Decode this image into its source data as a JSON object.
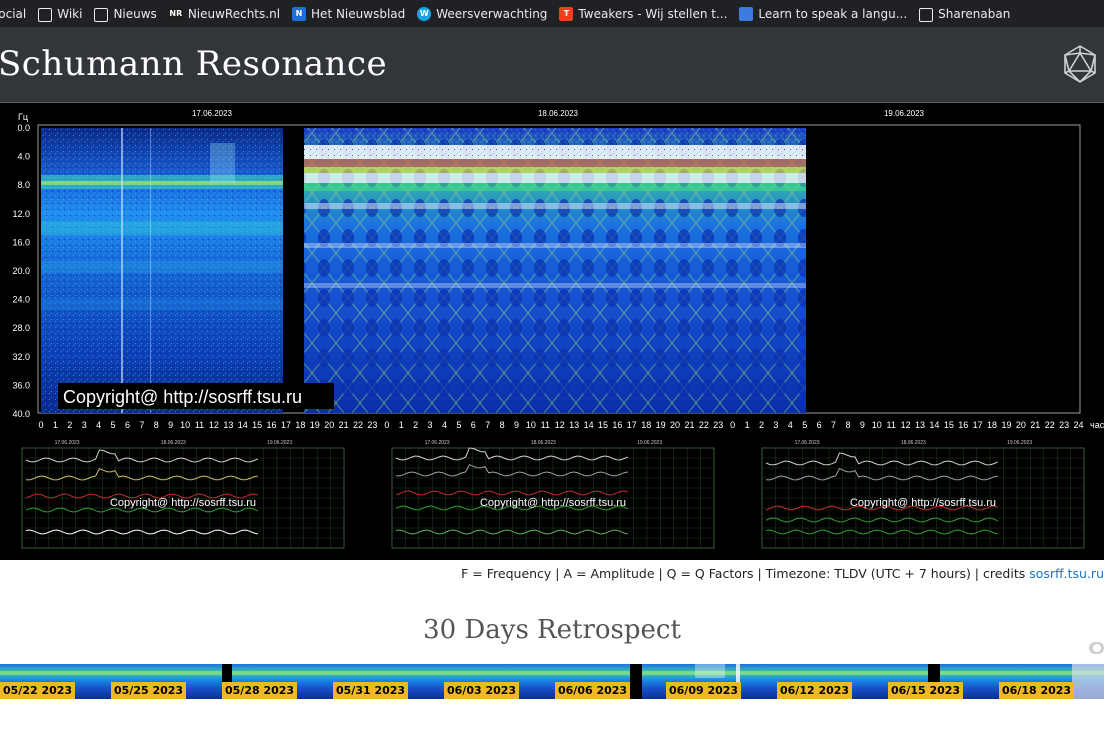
{
  "bookmarks": [
    {
      "label": "social",
      "icon": "folder-icon"
    },
    {
      "label": "Wiki",
      "icon": "folder-icon"
    },
    {
      "label": "Nieuws",
      "icon": "folder-icon"
    },
    {
      "label": "NieuwRechts.nl",
      "icon": "nieuwrechts-favicon",
      "badge": "NR",
      "color": "#1c1c1c"
    },
    {
      "label": "Het Nieuwsblad",
      "icon": "nieuwsblad-favicon",
      "badge": "N",
      "color": "#1e6fd9"
    },
    {
      "label": "Weersverwachting",
      "icon": "weather-favicon",
      "badge": "W",
      "color": "#1aa3e0"
    },
    {
      "label": "Tweakers - Wij stellen t...",
      "icon": "tweakers-favicon",
      "badge": "T",
      "color": "#e8431c"
    },
    {
      "label": "Learn to speak a langu...",
      "icon": "language-favicon",
      "badge": "",
      "color": "#3d7be0"
    },
    {
      "label": "Sharenaban",
      "icon": "folder-icon"
    }
  ],
  "page": {
    "title": "Schumann Resonance",
    "logo_icon": "icosahedron-icon"
  },
  "spectrogram": {
    "y_unit": "Гц",
    "x_unit": "час",
    "y_ticks": [
      "0.0",
      "4.0",
      "8.0",
      "12.0",
      "16.0",
      "20.0",
      "24.0",
      "28.0",
      "32.0",
      "36.0",
      "40.0"
    ],
    "dates": [
      "17.06.2023",
      "18.06.2023",
      "19.06.2023"
    ],
    "hour_ticks": [
      "0",
      "1",
      "2",
      "3",
      "4",
      "5",
      "6",
      "7",
      "8",
      "9",
      "10",
      "11",
      "12",
      "13",
      "14",
      "15",
      "16",
      "17",
      "18",
      "19",
      "20",
      "21",
      "22",
      "23",
      "0",
      "1",
      "2",
      "3",
      "4",
      "5",
      "6",
      "7",
      "8",
      "9",
      "10",
      "11",
      "12",
      "13",
      "14",
      "15",
      "16",
      "17",
      "18",
      "19",
      "20",
      "21",
      "22",
      "23",
      "0",
      "1",
      "2",
      "3",
      "4",
      "5",
      "6",
      "7",
      "8",
      "9",
      "10",
      "11",
      "12",
      "13",
      "14",
      "15",
      "16",
      "17",
      "18",
      "19",
      "20",
      "21",
      "22",
      "23",
      "24"
    ],
    "copyright": "Copyright@ http://sosrff.tsu.ru"
  },
  "subcharts": [
    {
      "name": "frequency-chart",
      "copyright": "Copyright@ http://sosrff.tsu.ru",
      "dates": [
        "17.06.2023",
        "18.06.2023",
        "19.06.2023"
      ]
    },
    {
      "name": "amplitude-chart",
      "copyright": "Copyright@ http://sosrff.tsu.ru",
      "dates": [
        "17.06.2023",
        "18.06.2023",
        "19.06.2023"
      ]
    },
    {
      "name": "q-factor-chart",
      "copyright": "Copyright@ http://sosrff.tsu.ru",
      "dates": [
        "17.06.2023",
        "18.06.2023",
        "19.06.2023"
      ]
    }
  ],
  "credits": {
    "text": "F = Frequency | A = Amplitude | Q = Q Factors | Timezone: TLDV (UTC + 7 hours) | credits ",
    "link": "sosrff.tsu.ru"
  },
  "retrospect": {
    "title": "30 Days Retrospect",
    "dates": [
      "05/22 2023",
      "05/25 2023",
      "05/28 2023",
      "05/31 2023",
      "06/03 2023",
      "06/06 2023",
      "06/09 2023",
      "06/12 2023",
      "06/15 2023",
      "06/18 2023"
    ]
  },
  "colors": {
    "bookmarks_bg": "#202124",
    "header_bg": "#32353a",
    "date_tag": "#f0b923",
    "link": "#1a73c8"
  }
}
